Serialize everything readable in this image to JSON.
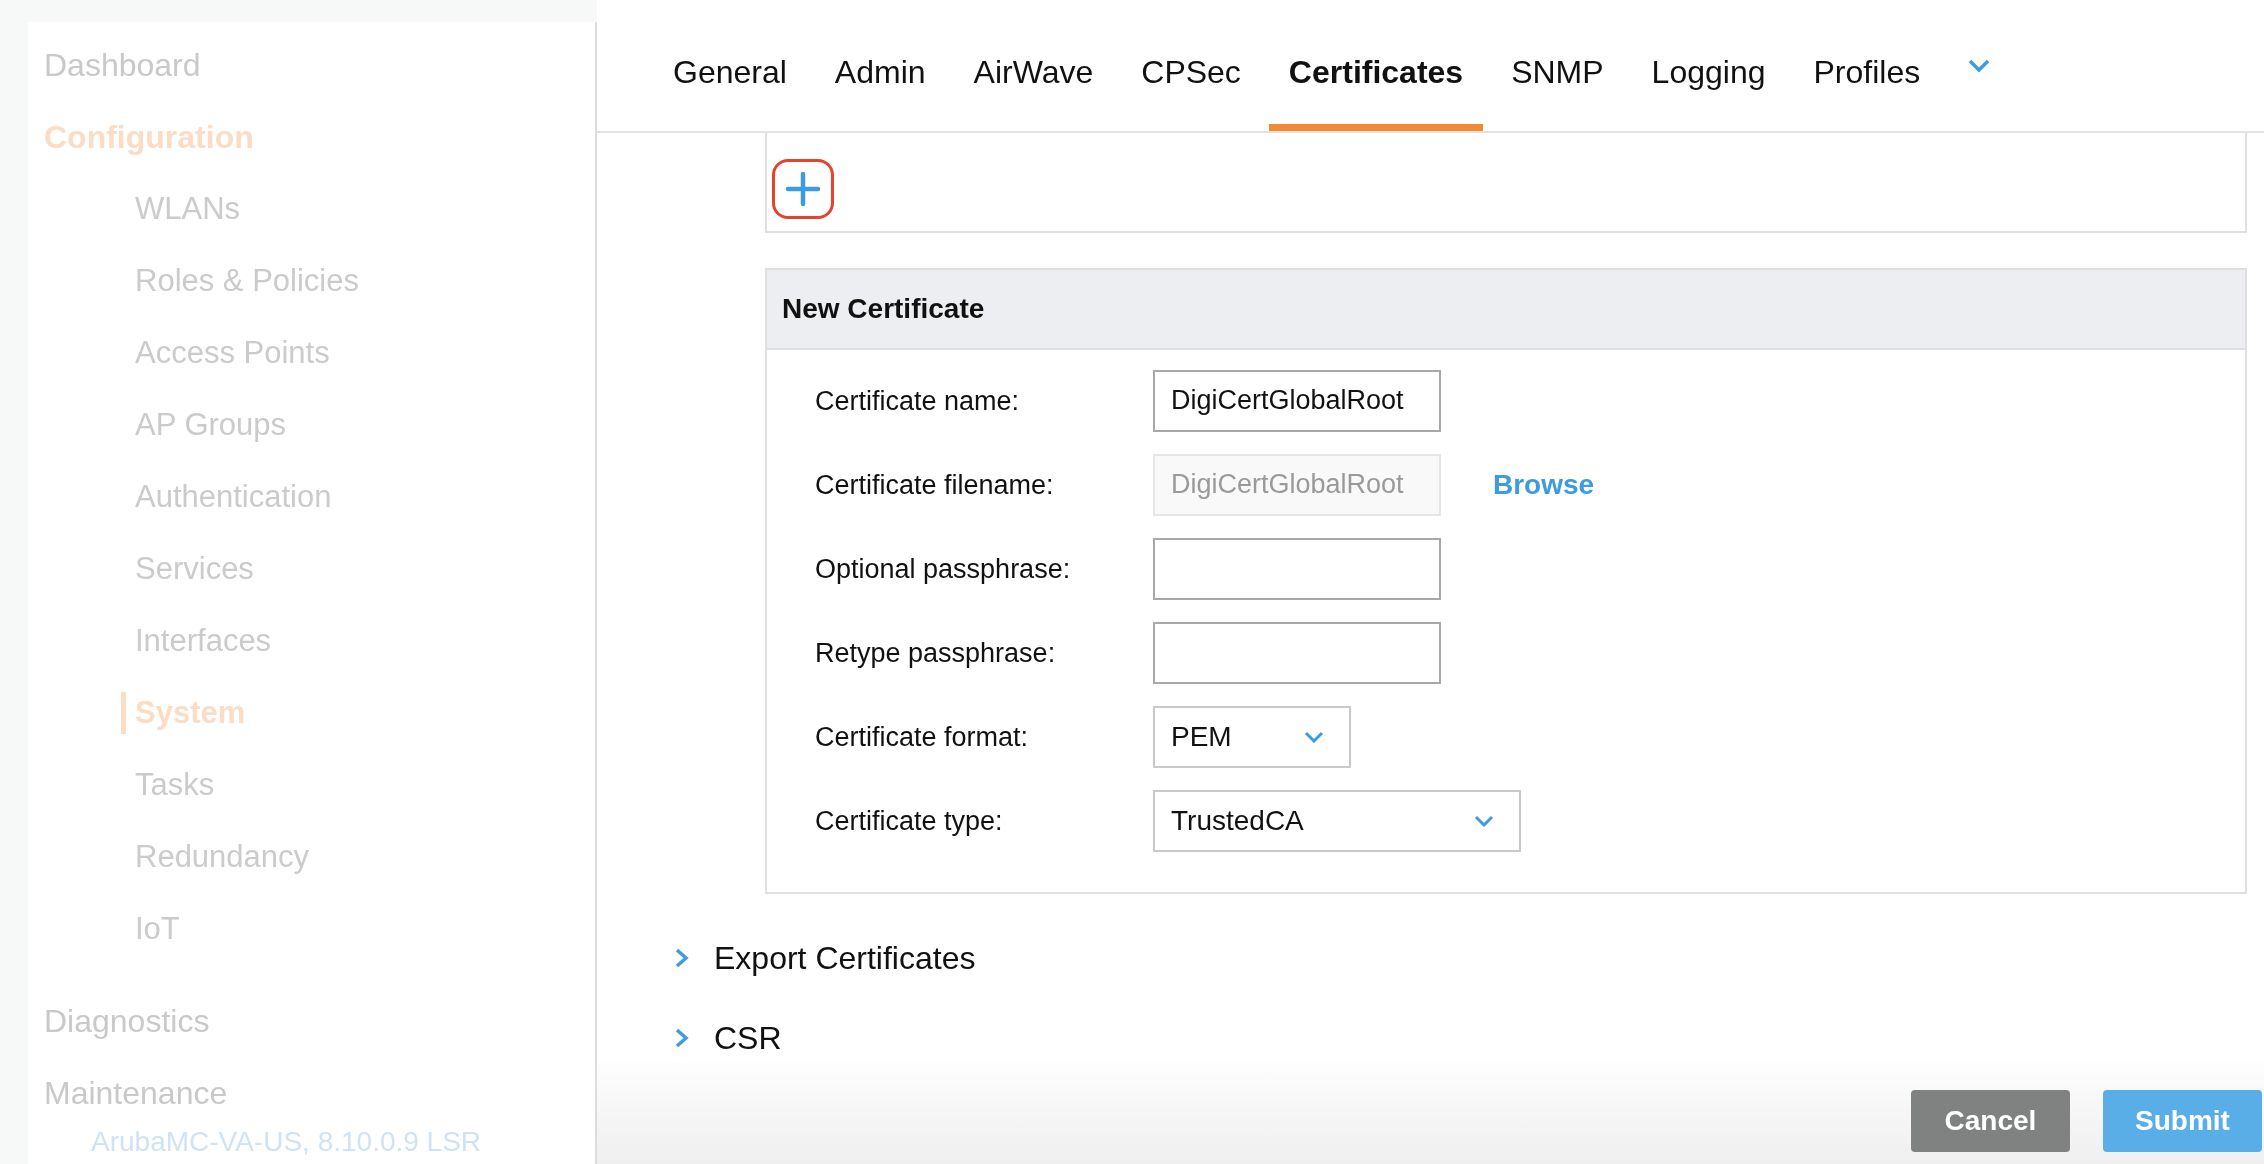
{
  "sidebar": {
    "items": [
      {
        "label": "Dashboard",
        "selected": false
      },
      {
        "label": "Configuration",
        "selected": true,
        "children": [
          {
            "label": "WLANs",
            "selected": false
          },
          {
            "label": "Roles & Policies",
            "selected": false
          },
          {
            "label": "Access Points",
            "selected": false
          },
          {
            "label": "AP Groups",
            "selected": false
          },
          {
            "label": "Authentication",
            "selected": false
          },
          {
            "label": "Services",
            "selected": false
          },
          {
            "label": "Interfaces",
            "selected": false
          },
          {
            "label": "System",
            "selected": true
          },
          {
            "label": "Tasks",
            "selected": false
          },
          {
            "label": "Redundancy",
            "selected": false
          },
          {
            "label": "IoT",
            "selected": false
          }
        ]
      },
      {
        "label": "Diagnostics",
        "selected": false
      },
      {
        "label": "Maintenance",
        "selected": false
      }
    ],
    "version": "ArubaMC-VA-US, 8.10.0.9 LSR"
  },
  "tabs": [
    {
      "label": "General",
      "selected": false
    },
    {
      "label": "Admin",
      "selected": false
    },
    {
      "label": "AirWave",
      "selected": false
    },
    {
      "label": "CPSec",
      "selected": false
    },
    {
      "label": "Certificates",
      "selected": true
    },
    {
      "label": "SNMP",
      "selected": false
    },
    {
      "label": "Logging",
      "selected": false
    },
    {
      "label": "Profiles",
      "selected": false
    }
  ],
  "new_certificate": {
    "title": "New Certificate",
    "fields": [
      {
        "kind": "text",
        "label": "Certificate name:",
        "value": "DigiCertGlobalRoot"
      },
      {
        "kind": "file",
        "label": "Certificate filename:",
        "value": "DigiCertGlobalRoot",
        "disabled": true,
        "action": "Browse"
      },
      {
        "kind": "password",
        "label": "Optional passphrase:"
      },
      {
        "kind": "password",
        "label": "Retype passphrase:"
      },
      {
        "kind": "select",
        "label": "Certificate format:",
        "value": "PEM"
      },
      {
        "kind": "select",
        "label": "Certificate type:",
        "value": "TrustedCA"
      }
    ]
  },
  "sections": [
    {
      "label": "Export Certificates",
      "expanded": false
    },
    {
      "label": "CSR",
      "expanded": false
    }
  ],
  "buttons": [
    {
      "label": "Cancel",
      "kind": "secondary"
    },
    {
      "label": "Submit",
      "kind": "primary"
    }
  ]
}
